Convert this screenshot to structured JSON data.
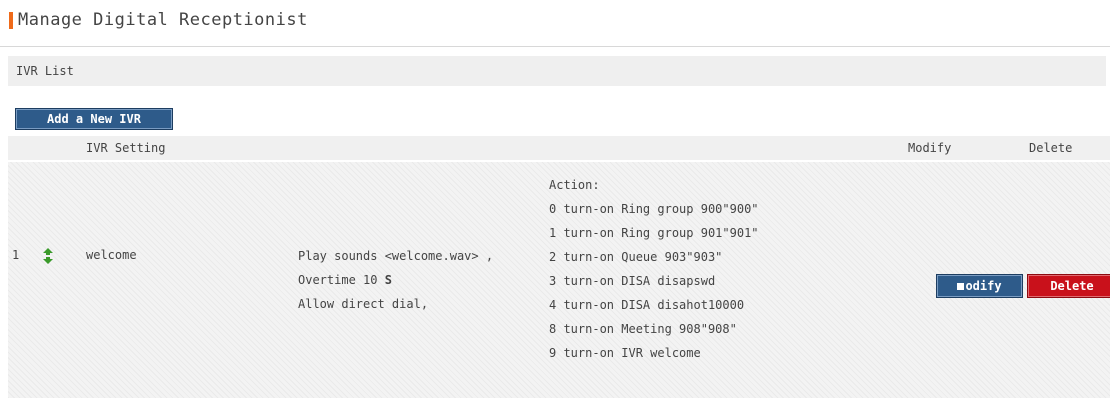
{
  "page": {
    "title": "Manage Digital Receptionist"
  },
  "section": {
    "title": "IVR List"
  },
  "toolbar": {
    "add_label": "Add a New IVR"
  },
  "table": {
    "headers": {
      "setting": "IVR Setting",
      "modify": "Modify",
      "delete": "Delete"
    },
    "rows": [
      {
        "index": "1",
        "name": "welcome",
        "play": "Play sounds <welcome.wav> ,",
        "overtime_prefix": "Overtime 10 ",
        "overtime_unit": "S",
        "direct_dial": "Allow direct dial,",
        "actions": [
          "Action:",
          "0 turn-on Ring group 900\"900\"",
          "1 turn-on Ring group 901\"901\"",
          "2 turn-on Queue 903\"903\"",
          "3 turn-on DISA disapswd",
          "4 turn-on DISA disahot10000",
          "8 turn-on Meeting 908\"908\"",
          "9 turn-on IVR welcome"
        ],
        "modify_label": "odify",
        "delete_label": "Delete"
      }
    ]
  },
  "colors": {
    "accent": "#ef6a1a",
    "button_blue": "#2e5b8a",
    "button_red": "#c9111b",
    "sort_icon": "#3a9a2a"
  },
  "icons": {
    "sort": "up-down-arrow-icon"
  }
}
